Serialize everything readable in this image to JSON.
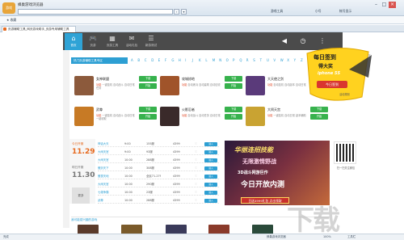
{
  "window": {
    "title": "蜂巢游戏浏览器",
    "logo_text": "游戏",
    "address": "",
    "menu_right": [
      "游戏工具",
      "小号",
      "帐号显示"
    ]
  },
  "menubar": {
    "items": [
      "★ 收藏"
    ]
  },
  "tab": {
    "label": "页游辅助工具_网页游戏助手_页游专用辅助工具"
  },
  "game_nav": [
    {
      "icon": "⌂",
      "label": "首页"
    },
    {
      "icon": "🎮",
      "label": "页游"
    },
    {
      "icon": "▦",
      "label": "页游工具"
    },
    {
      "icon": "✉",
      "label": "活动礼包"
    },
    {
      "icon": "☰",
      "label": "新游测试"
    }
  ],
  "header_icons": [
    "volume-icon",
    "clock-icon",
    "more-icon"
  ],
  "zone": {
    "label": "热门页游辅助工具专区",
    "letters": [
      "A",
      "B",
      "C",
      "D",
      "E",
      "F",
      "G",
      "H",
      "I",
      "J",
      "K",
      "L",
      "M",
      "N",
      "O",
      "P",
      "Q",
      "R",
      "S",
      "T",
      "U",
      "V",
      "W",
      "X",
      "Y",
      "Z"
    ]
  },
  "games": [
    {
      "name": "女神联盟",
      "tag": "功能",
      "desc": "一键挂机 自动战斗 自动日常任务",
      "btn1": "下载",
      "btn2": "开始",
      "color": "#8c5a3c"
    },
    {
      "name": "攻城掠地",
      "tag": "功能",
      "desc": "自动练兵 自动建筑 自动征收",
      "btn1": "下载",
      "btn2": "开始",
      "color": "#a0542a"
    },
    {
      "name": "大天使之剑",
      "tag": "功能",
      "desc": "自动挂机 自动副本 自动日常",
      "btn1": "下载",
      "btn2": "开始",
      "color": "#5a3a7a"
    },
    {
      "name": "武尊",
      "tag": "功能",
      "desc": "一键挂机 自动战斗 自动日常 一键收取",
      "btn1": "下载",
      "btn2": "开始",
      "color": "#c77a25"
    },
    {
      "name": "火影忍者",
      "tag": "功能",
      "desc": "自动战斗 自动任务 自动日常",
      "btn1": "下载",
      "btn2": "开始",
      "color": "#3a2a2a"
    },
    {
      "name": "大闹天宫",
      "tag": "功能",
      "desc": "一键挂机 自动日常 副本辅助",
      "btn1": "下载",
      "btn2": "开始",
      "color": "#c9a332"
    }
  ],
  "server": {
    "today_label": "今日开服",
    "today_date": "11.29",
    "tomorrow_label": "明日开服",
    "tomorrow_date": "11.30",
    "more": "更多",
    "rows": [
      {
        "game": "神话大天",
        "time": "9:00",
        "server": "155服",
        "platform": "4399",
        "btn": "进入"
      },
      {
        "game": "大闹天宫",
        "time": "9:00",
        "server": "93服",
        "platform": "4399",
        "btn": "进入"
      },
      {
        "game": "大闹天宫",
        "time": "10:00",
        "server": "288服",
        "platform": "4399",
        "btn": "进入"
      },
      {
        "game": "傲剑天下",
        "time": "10:00",
        "server": "308服",
        "platform": "4399",
        "btn": "进入"
      },
      {
        "game": "傲视天地",
        "time": "10:00",
        "server": "全民71-27f",
        "platform": "4399",
        "btn": "进入"
      },
      {
        "game": "大闹天宫",
        "time": "10:00",
        "server": "290服",
        "platform": "4399",
        "btn": "进入"
      },
      {
        "game": "七雄争霸",
        "time": "10:00",
        "server": "23服",
        "platform": "4399",
        "btn": "进入"
      },
      {
        "game": "武尊",
        "time": "10:00",
        "server": "288服",
        "platform": "4399",
        "btn": "进入"
      }
    ]
  },
  "banner": {
    "line1": "华丽连招技能",
    "line2": "无限激情野战",
    "line3": "3D战斗网游巨作",
    "line4": "今日开放内测",
    "cta": "日送4999礼包 点击领取"
  },
  "qr": {
    "caption": "扫一扫关注微信"
  },
  "recent": {
    "label": "我可能感兴趣的游戏"
  },
  "promo": {
    "line1": "每日签到",
    "line2": "得大奖",
    "line3": "iphone 5S",
    "button": "今日签到",
    "rule": "活动规则"
  },
  "watermark": "下载",
  "statusbar": {
    "left": "完成",
    "right": [
      "蜂巢游戏浏览器",
      "100%",
      "工具栏"
    ]
  }
}
